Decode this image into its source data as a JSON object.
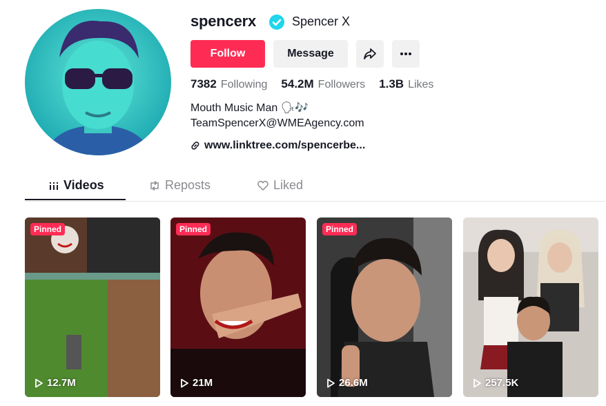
{
  "profile": {
    "username": "spencerx",
    "nickname": "Spencer X",
    "verified": true,
    "bio_line1": "Mouth Music Man 🗣🎶",
    "bio_line2": "TeamSpencerX@WMEAgency.com",
    "link": "www.linktree.com/spencerbe..."
  },
  "actions": {
    "follow_label": "Follow",
    "message_label": "Message",
    "share_icon": "share-icon",
    "more_icon": "more-icon"
  },
  "stats": {
    "following_count": "7382",
    "following_label": "Following",
    "followers_count": "54.2M",
    "followers_label": "Followers",
    "likes_count": "1.3B",
    "likes_label": "Likes"
  },
  "tabs": [
    {
      "label": "Videos",
      "active": true
    },
    {
      "label": "Reposts",
      "active": false
    },
    {
      "label": "Liked",
      "active": false
    }
  ],
  "videos": [
    {
      "pinned_label": "Pinned",
      "views": "12.7M"
    },
    {
      "pinned_label": "Pinned",
      "views": "21M"
    },
    {
      "pinned_label": "Pinned",
      "views": "26.6M"
    },
    {
      "pinned_label": "",
      "views": "257.5K"
    }
  ],
  "colors": {
    "accent": "#fe2c55",
    "verified": "#20d5ec",
    "text": "#161823",
    "muted": "#73757c"
  }
}
